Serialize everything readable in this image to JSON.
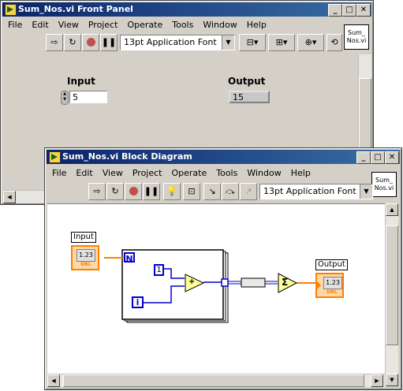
{
  "front_panel": {
    "title": "Sum_Nos.vi Front Panel",
    "menu": [
      "File",
      "Edit",
      "View",
      "Project",
      "Operate",
      "Tools",
      "Window",
      "Help"
    ],
    "font_selector": "13pt Application Font",
    "vi_icon_text": "Sum_ Nos.vi",
    "input_label": "Input",
    "input_value": "5",
    "output_label": "Output",
    "output_value": "15"
  },
  "block_diagram": {
    "title": "Sum_Nos.vi Block Diagram",
    "menu": [
      "File",
      "Edit",
      "View",
      "Project",
      "Operate",
      "Tools",
      "Window",
      "Help"
    ],
    "font_selector": "13pt Application Font",
    "vi_icon_text": "Sum_ Nos.vi",
    "input_label": "Input",
    "input_terminal_value": "1.23",
    "input_terminal_type": "DBL",
    "output_label": "Output",
    "output_terminal_value": "1.23",
    "output_terminal_type": "DBL",
    "loop_count_label": "N",
    "constant_value": "1",
    "iteration_label": "i",
    "add_symbol": "+",
    "sum_symbol": "Σ"
  },
  "icons": {
    "run": "run-arrow-icon",
    "run_continuous": "run-continuously-icon",
    "abort": "abort-icon",
    "pause": "pause-icon",
    "highlight": "highlight-execution-icon",
    "retain_values": "retain-wire-values-icon",
    "step_into": "step-into-icon",
    "step_over": "step-over-icon",
    "step_out": "step-out-icon",
    "align": "align-objects-icon",
    "distribute": "distribute-objects-icon",
    "resize": "resize-objects-icon",
    "reorder": "reorder-icon"
  },
  "colors": {
    "titlebar_active": "#0a246a",
    "orange_terminal": "#ff8000",
    "wire_orange": "#ff7f00",
    "wire_blue": "#0000cc",
    "panel_bg": "#d4d0c8"
  }
}
